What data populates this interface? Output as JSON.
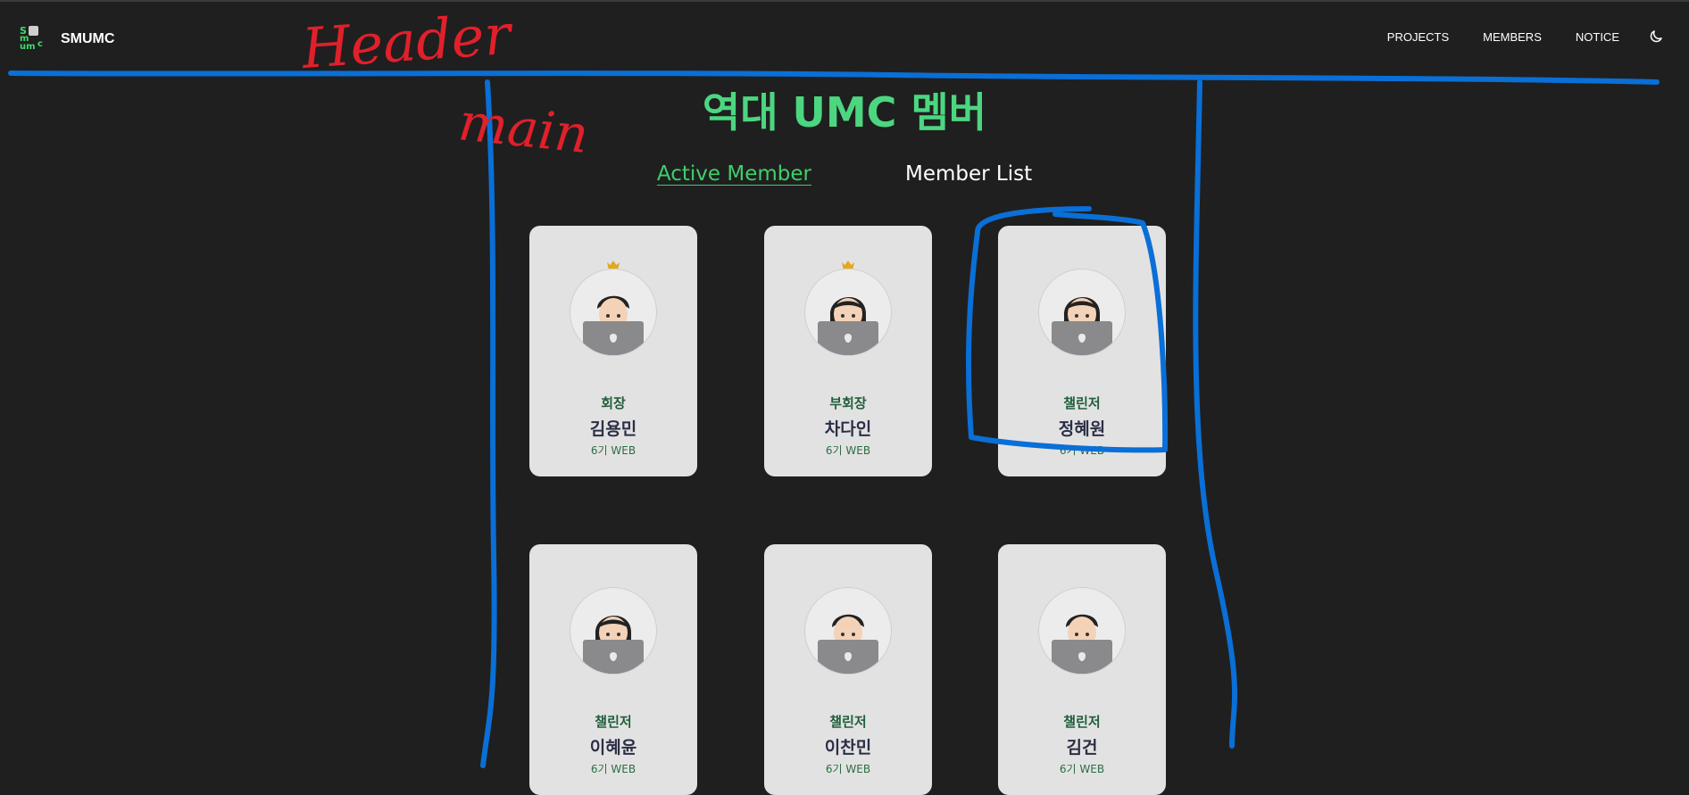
{
  "header": {
    "brand": "SMUMC",
    "logo_text": "SMUMC",
    "nav": [
      "PROJECTS",
      "MEMBERS",
      "NOTICE"
    ],
    "theme_icon": "moon-icon"
  },
  "main": {
    "title": "역대 UMC 멤버",
    "tabs": [
      {
        "label": "Active Member",
        "active": true
      },
      {
        "label": "Member List",
        "active": false
      }
    ],
    "members": [
      {
        "role": "회장",
        "name": "김용민",
        "generation": "6기 WEB",
        "crown": true,
        "avatar": "male-technologist-icon"
      },
      {
        "role": "부회장",
        "name": "차다인",
        "generation": "6기 WEB",
        "crown": true,
        "avatar": "female-technologist-icon"
      },
      {
        "role": "챌린저",
        "name": "정혜원",
        "generation": "6기 WEB",
        "crown": false,
        "avatar": "female-technologist-icon"
      },
      {
        "role": "챌린저",
        "name": "이혜윤",
        "generation": "6기 WEB",
        "crown": false,
        "avatar": "female-technologist-icon"
      },
      {
        "role": "챌린저",
        "name": "이찬민",
        "generation": "6기 WEB",
        "crown": false,
        "avatar": "male-technologist-icon"
      },
      {
        "role": "챌린저",
        "name": "김건",
        "generation": "6기 WEB",
        "crown": false,
        "avatar": "male-technologist-icon"
      }
    ]
  },
  "annotations": {
    "header_label": "Header",
    "main_label": "main"
  },
  "colors": {
    "background": "#1f1f1f",
    "accent_green": "#4cd680",
    "card": "#e3e2e3",
    "annotation_blue": "#0a6fd6",
    "annotation_red": "#e0202a"
  }
}
